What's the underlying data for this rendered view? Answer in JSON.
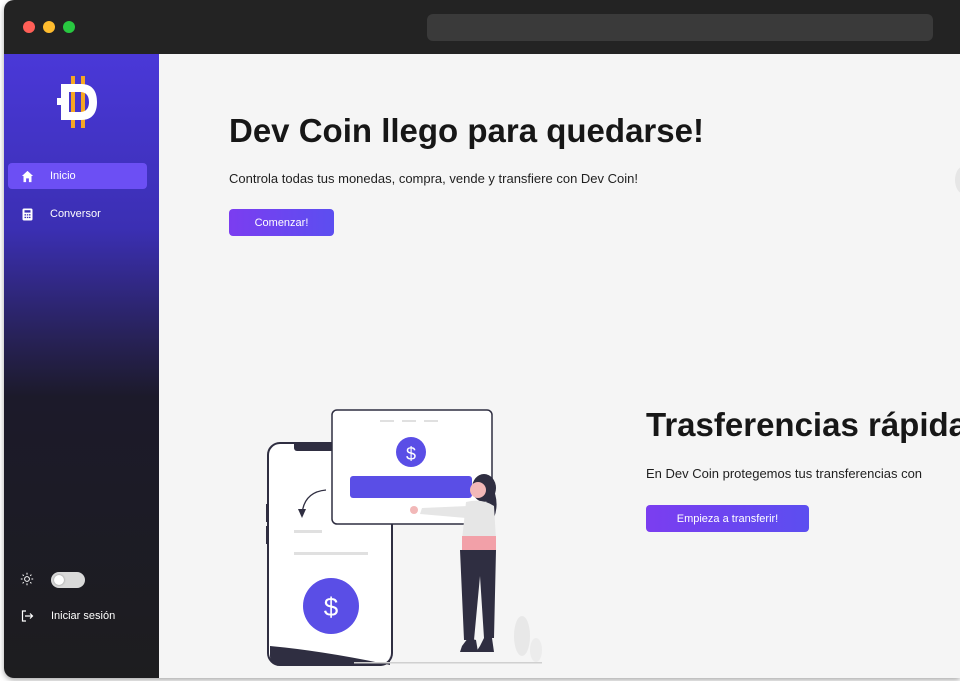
{
  "sidebar": {
    "items": [
      {
        "label": "Inicio",
        "icon": "home-icon",
        "active": true
      },
      {
        "label": "Conversor",
        "icon": "calculator-icon",
        "active": false
      }
    ],
    "theme_toggle_icon": "sun-icon",
    "login_label": "Iniciar sesión",
    "login_icon": "login-icon"
  },
  "hero": {
    "title": "Dev Coin llego para quedarse!",
    "subtitle": "Controla todas tus monedas, compra, vende y transfiere con Dev Coin!",
    "button_label": "Comenzar!"
  },
  "transfers": {
    "title": "Trasferencias rápidas",
    "subtitle": "En Dev Coin protegemos tus transferencias con",
    "button_label": "Empieza a transferir!"
  },
  "illustration": {
    "currency_symbol": "$"
  },
  "colors": {
    "accent": "#6c4ff4",
    "sidebar_top": "#4a38d8",
    "sidebar_bottom": "#1d1d1f",
    "logo_gold": "#f5a623"
  }
}
